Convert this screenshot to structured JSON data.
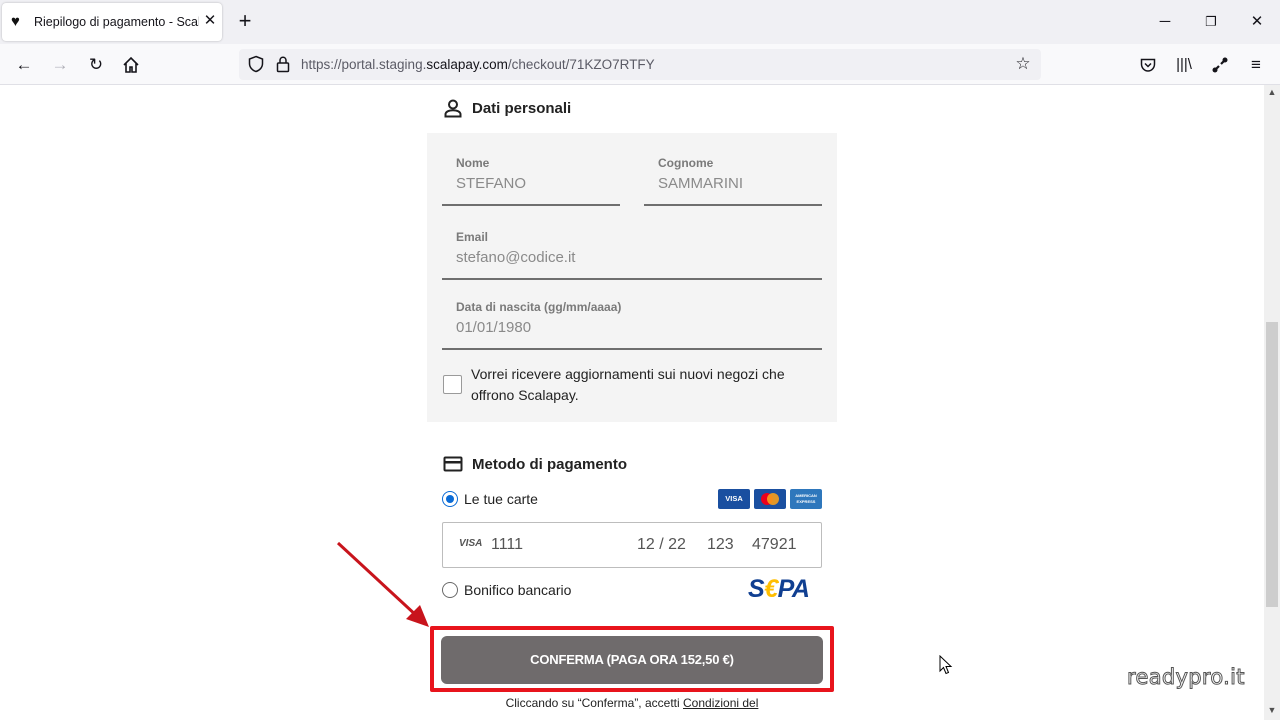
{
  "browser": {
    "tab_title": "Riepilogo di pagamento - Scalapay",
    "url_prefix": "https://portal.staging.",
    "url_domain": "scalapay.com",
    "url_path": "/checkout/71KZO7RTFY"
  },
  "personal": {
    "section_title": "Dati personali",
    "first_name_label": "Nome",
    "first_name_value": "STEFANO",
    "last_name_label": "Cognome",
    "last_name_value": "SAMMARINI",
    "email_label": "Email",
    "email_value": "stefano@codice.it",
    "birth_label": "Data di nascita (gg/mm/aaaa)",
    "birth_value": "01/01/1980",
    "newsletter_label": "Vorrei ricevere aggiornamenti sui nuovi negozi che offrono Scalapay.",
    "newsletter_checked": false
  },
  "payment": {
    "section_title": "Metodo di pagamento",
    "cards_option_label": "Le tue carte",
    "cards_option_selected": true,
    "card_brand_logos": [
      "VISA",
      "mastercard",
      "AMERICAN EXPRESS"
    ],
    "saved_card": {
      "brand": "VISA",
      "last_digits": "1111",
      "expiry": "12 / 22",
      "cvv": "123",
      "zip": "47921"
    },
    "bank_option_label": "Bonifico bancario",
    "bank_option_selected": false,
    "sepa_logo_text": "S€PA"
  },
  "confirm_button_label": "CONFERMA (PAGA ORA  152,50 €)",
  "footnote_prefix": "Cliccando su “Conferma”, accetti ",
  "footnote_link": "Condizioni del",
  "watermark": "readypro.it",
  "colors": {
    "highlight": "#e8141c",
    "button": "#6f6b6c",
    "radio_selected": "#0a6bd6"
  }
}
